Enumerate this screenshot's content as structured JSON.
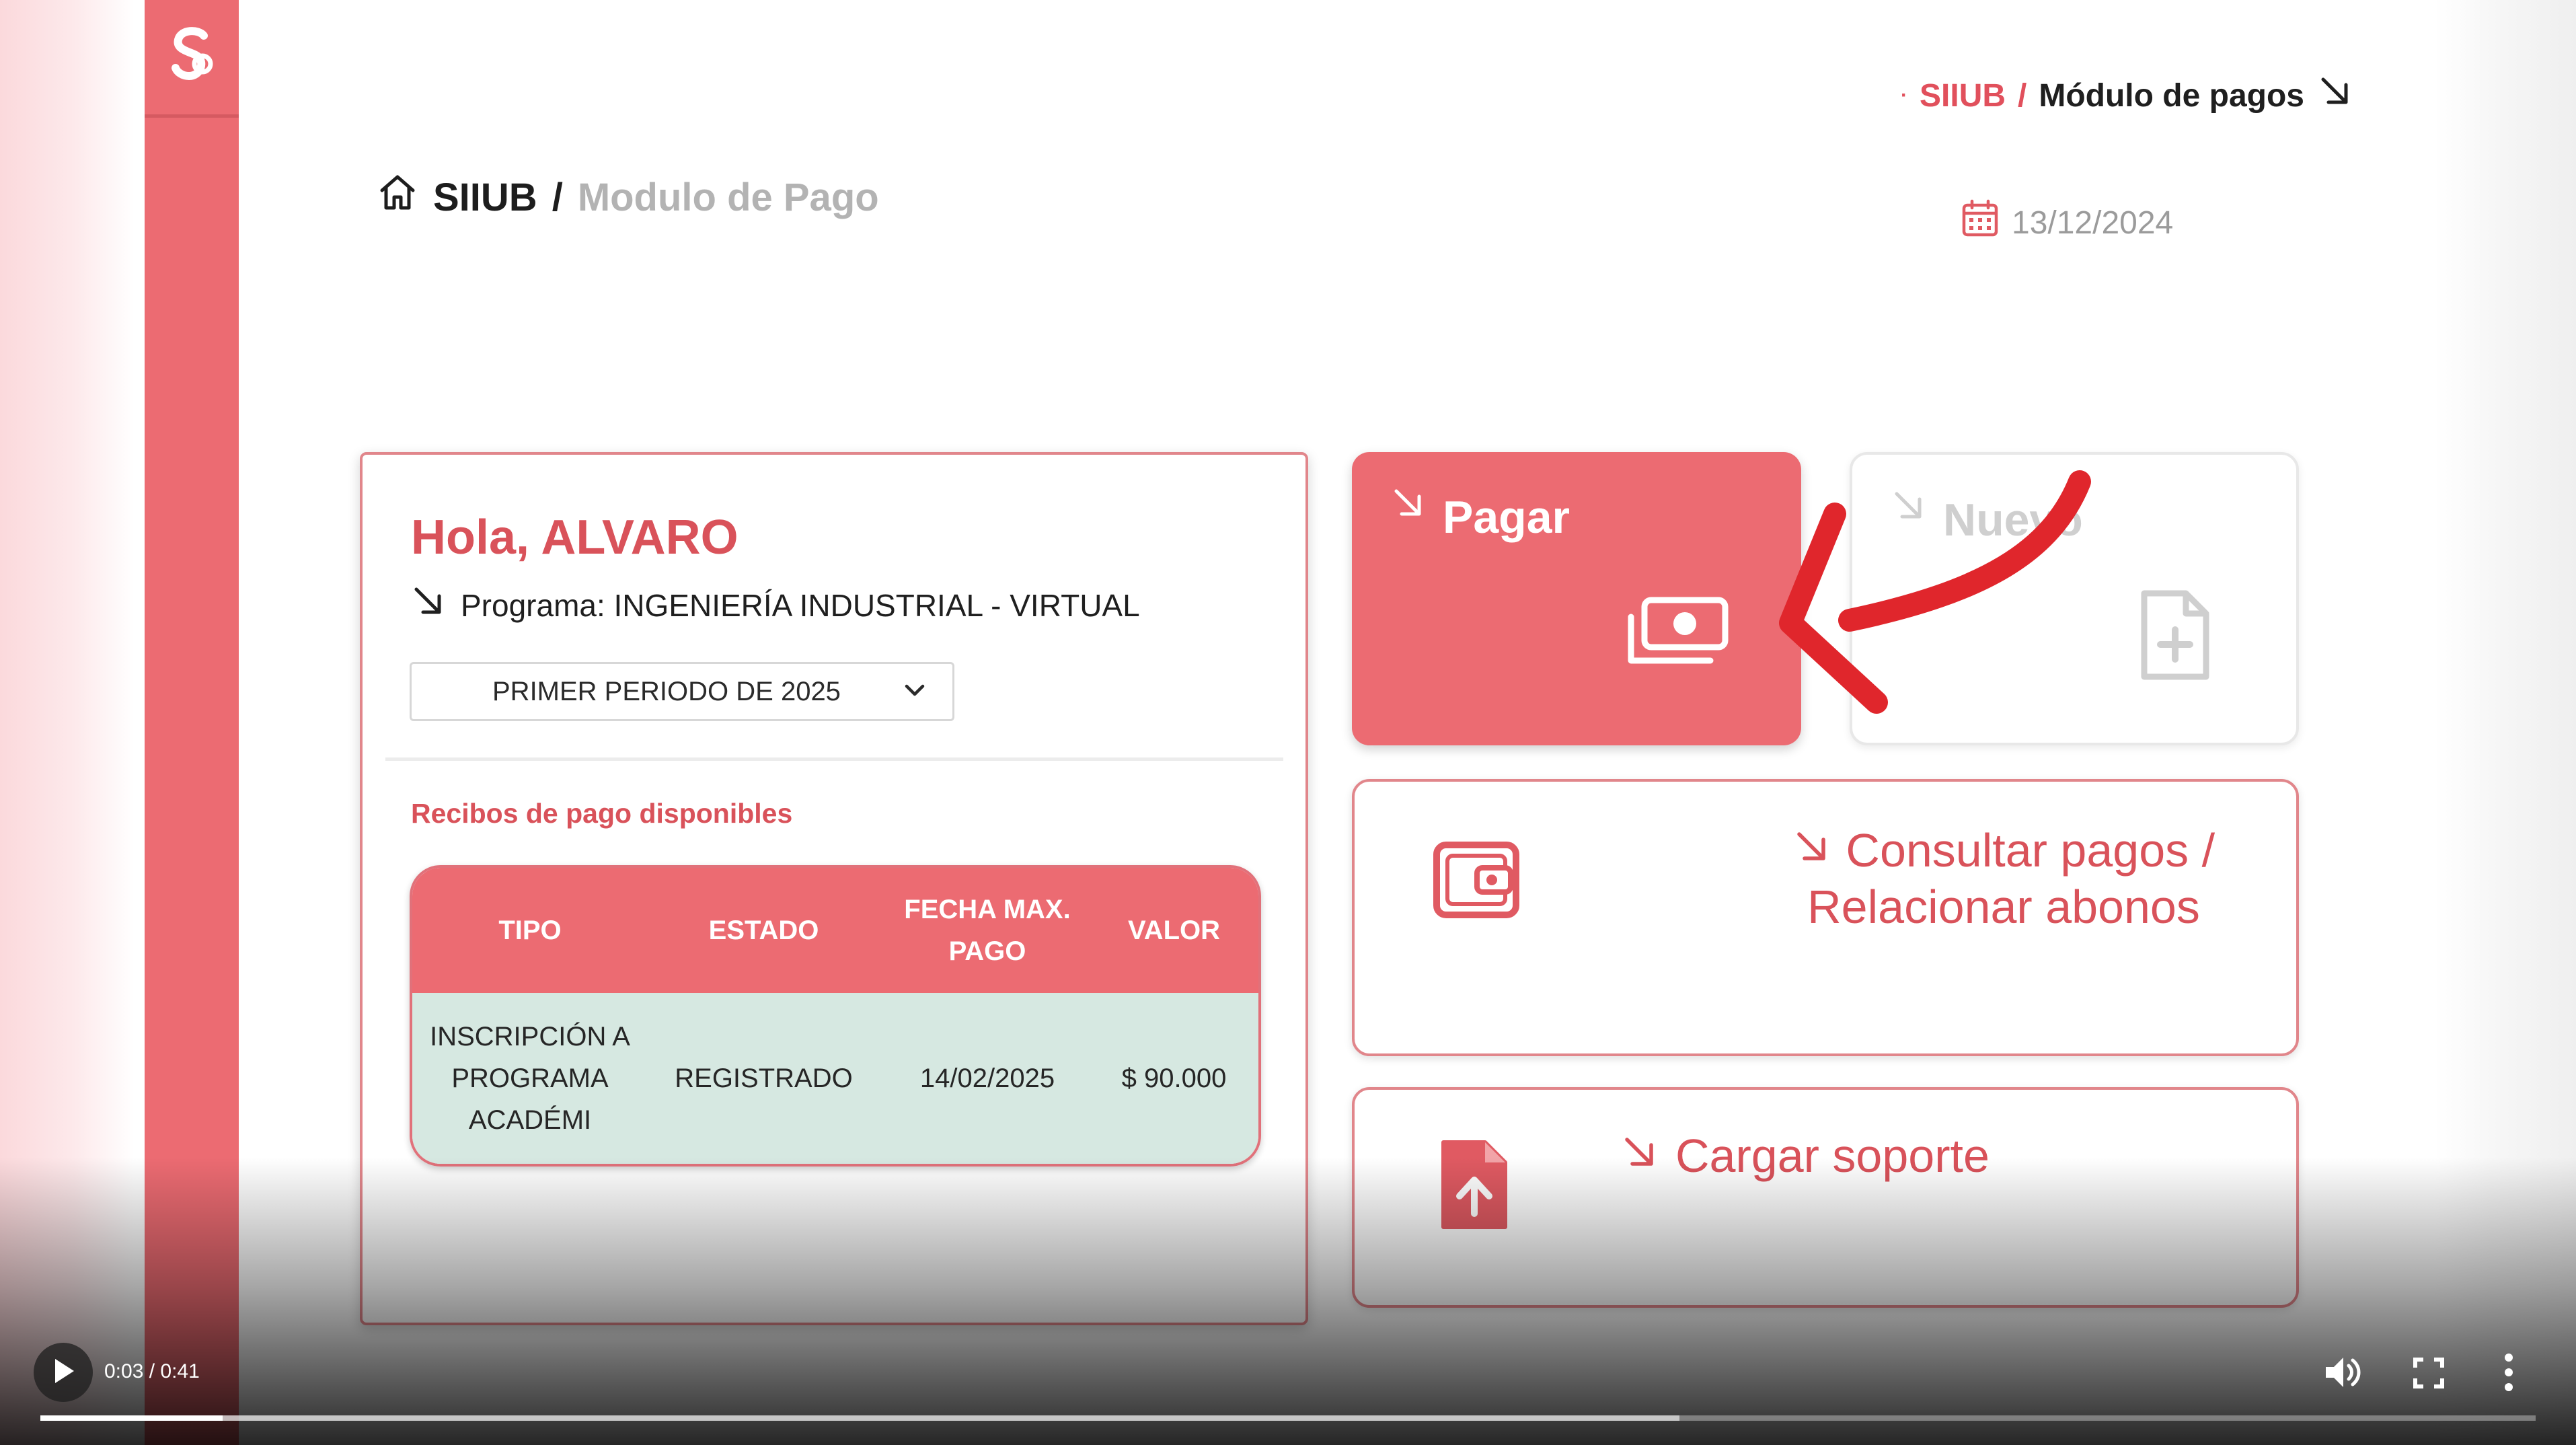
{
  "header": {
    "top_breadcrumb": {
      "dot": "·",
      "root": "SIIUB",
      "separator": "/",
      "current": "Módulo de pagos"
    },
    "breadcrumb": {
      "root": "SIIUB",
      "separator": "/",
      "current": "Modulo de Pago"
    },
    "date": "13/12/2024"
  },
  "student_card": {
    "greeting": "Hola, ALVARO",
    "program": "Programa: INGENIERÍA INDUSTRIAL - VIRTUAL",
    "period_select": "PRIMER PERIODO DE 2025",
    "receipts_label": "Recibos de pago disponibles",
    "table": {
      "headers": [
        "TIPO",
        "ESTADO",
        "FECHA MAX. PAGO",
        "VALOR"
      ],
      "rows": [
        [
          "INSCRIPCIÓN A PROGRAMA ACADÉMI",
          "REGISTRADO",
          "14/02/2025",
          "$ 90.000"
        ]
      ]
    }
  },
  "tiles": {
    "pagar": "Pagar",
    "nuevo": "Nuevo",
    "consultar": "Consultar pagos / Relacionar abonos",
    "cargar": "Cargar soporte"
  },
  "video": {
    "time": "0:03 / 0:41",
    "progress": 0.073,
    "buffered": 0.657
  },
  "icons": [
    "logo-icon",
    "home-icon",
    "calendar-icon",
    "arrow-down-right-icon",
    "chevron-down-icon",
    "money-icon",
    "file-plus-icon",
    "wallet-icon",
    "file-upload-icon",
    "play-icon",
    "volume-icon",
    "fullscreen-icon",
    "more-vertical-icon"
  ],
  "colors": {
    "brand": "#ec6b72",
    "accent_text": "#d9525a",
    "row_bg": "#d6e8e1",
    "annotation": "#e0262c"
  }
}
